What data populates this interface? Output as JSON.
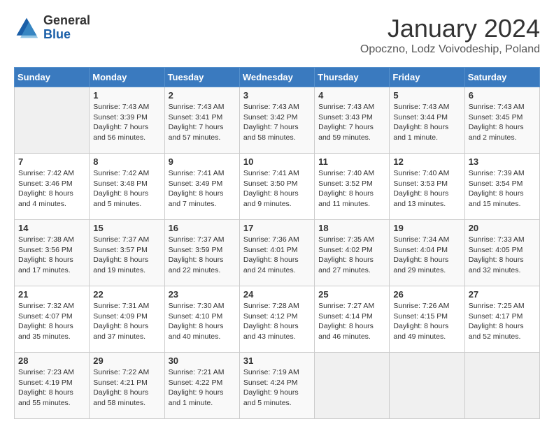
{
  "header": {
    "logo_general": "General",
    "logo_blue": "Blue",
    "month_title": "January 2024",
    "location": "Opoczno, Lodz Voivodeship, Poland"
  },
  "weekdays": [
    "Sunday",
    "Monday",
    "Tuesday",
    "Wednesday",
    "Thursday",
    "Friday",
    "Saturday"
  ],
  "weeks": [
    [
      {
        "day": "",
        "info": ""
      },
      {
        "day": "1",
        "info": "Sunrise: 7:43 AM\nSunset: 3:39 PM\nDaylight: 7 hours\nand 56 minutes."
      },
      {
        "day": "2",
        "info": "Sunrise: 7:43 AM\nSunset: 3:41 PM\nDaylight: 7 hours\nand 57 minutes."
      },
      {
        "day": "3",
        "info": "Sunrise: 7:43 AM\nSunset: 3:42 PM\nDaylight: 7 hours\nand 58 minutes."
      },
      {
        "day": "4",
        "info": "Sunrise: 7:43 AM\nSunset: 3:43 PM\nDaylight: 7 hours\nand 59 minutes."
      },
      {
        "day": "5",
        "info": "Sunrise: 7:43 AM\nSunset: 3:44 PM\nDaylight: 8 hours\nand 1 minute."
      },
      {
        "day": "6",
        "info": "Sunrise: 7:43 AM\nSunset: 3:45 PM\nDaylight: 8 hours\nand 2 minutes."
      }
    ],
    [
      {
        "day": "7",
        "info": "Sunrise: 7:42 AM\nSunset: 3:46 PM\nDaylight: 8 hours\nand 4 minutes."
      },
      {
        "day": "8",
        "info": "Sunrise: 7:42 AM\nSunset: 3:48 PM\nDaylight: 8 hours\nand 5 minutes."
      },
      {
        "day": "9",
        "info": "Sunrise: 7:41 AM\nSunset: 3:49 PM\nDaylight: 8 hours\nand 7 minutes."
      },
      {
        "day": "10",
        "info": "Sunrise: 7:41 AM\nSunset: 3:50 PM\nDaylight: 8 hours\nand 9 minutes."
      },
      {
        "day": "11",
        "info": "Sunrise: 7:40 AM\nSunset: 3:52 PM\nDaylight: 8 hours\nand 11 minutes."
      },
      {
        "day": "12",
        "info": "Sunrise: 7:40 AM\nSunset: 3:53 PM\nDaylight: 8 hours\nand 13 minutes."
      },
      {
        "day": "13",
        "info": "Sunrise: 7:39 AM\nSunset: 3:54 PM\nDaylight: 8 hours\nand 15 minutes."
      }
    ],
    [
      {
        "day": "14",
        "info": "Sunrise: 7:38 AM\nSunset: 3:56 PM\nDaylight: 8 hours\nand 17 minutes."
      },
      {
        "day": "15",
        "info": "Sunrise: 7:37 AM\nSunset: 3:57 PM\nDaylight: 8 hours\nand 19 minutes."
      },
      {
        "day": "16",
        "info": "Sunrise: 7:37 AM\nSunset: 3:59 PM\nDaylight: 8 hours\nand 22 minutes."
      },
      {
        "day": "17",
        "info": "Sunrise: 7:36 AM\nSunset: 4:01 PM\nDaylight: 8 hours\nand 24 minutes."
      },
      {
        "day": "18",
        "info": "Sunrise: 7:35 AM\nSunset: 4:02 PM\nDaylight: 8 hours\nand 27 minutes."
      },
      {
        "day": "19",
        "info": "Sunrise: 7:34 AM\nSunset: 4:04 PM\nDaylight: 8 hours\nand 29 minutes."
      },
      {
        "day": "20",
        "info": "Sunrise: 7:33 AM\nSunset: 4:05 PM\nDaylight: 8 hours\nand 32 minutes."
      }
    ],
    [
      {
        "day": "21",
        "info": "Sunrise: 7:32 AM\nSunset: 4:07 PM\nDaylight: 8 hours\nand 35 minutes."
      },
      {
        "day": "22",
        "info": "Sunrise: 7:31 AM\nSunset: 4:09 PM\nDaylight: 8 hours\nand 37 minutes."
      },
      {
        "day": "23",
        "info": "Sunrise: 7:30 AM\nSunset: 4:10 PM\nDaylight: 8 hours\nand 40 minutes."
      },
      {
        "day": "24",
        "info": "Sunrise: 7:28 AM\nSunset: 4:12 PM\nDaylight: 8 hours\nand 43 minutes."
      },
      {
        "day": "25",
        "info": "Sunrise: 7:27 AM\nSunset: 4:14 PM\nDaylight: 8 hours\nand 46 minutes."
      },
      {
        "day": "26",
        "info": "Sunrise: 7:26 AM\nSunset: 4:15 PM\nDaylight: 8 hours\nand 49 minutes."
      },
      {
        "day": "27",
        "info": "Sunrise: 7:25 AM\nSunset: 4:17 PM\nDaylight: 8 hours\nand 52 minutes."
      }
    ],
    [
      {
        "day": "28",
        "info": "Sunrise: 7:23 AM\nSunset: 4:19 PM\nDaylight: 8 hours\nand 55 minutes."
      },
      {
        "day": "29",
        "info": "Sunrise: 7:22 AM\nSunset: 4:21 PM\nDaylight: 8 hours\nand 58 minutes."
      },
      {
        "day": "30",
        "info": "Sunrise: 7:21 AM\nSunset: 4:22 PM\nDaylight: 9 hours\nand 1 minute."
      },
      {
        "day": "31",
        "info": "Sunrise: 7:19 AM\nSunset: 4:24 PM\nDaylight: 9 hours\nand 5 minutes."
      },
      {
        "day": "",
        "info": ""
      },
      {
        "day": "",
        "info": ""
      },
      {
        "day": "",
        "info": ""
      }
    ]
  ]
}
